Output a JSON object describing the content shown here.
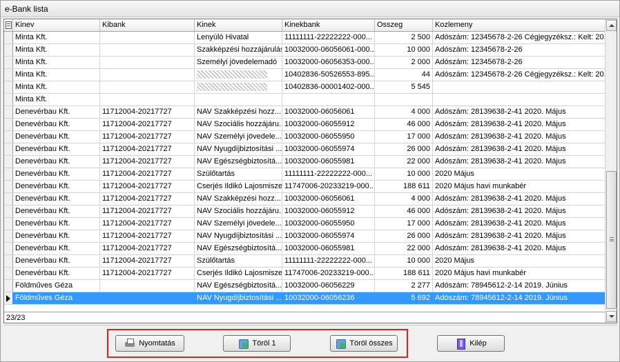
{
  "window": {
    "title": "e-Bank lista"
  },
  "columns": [
    "Kinev",
    "Kibank",
    "Kinek",
    "Kinekbank",
    "Osszeg",
    "Kozlemeny"
  ],
  "rows": [
    [
      "Minta Kft.",
      "",
      "Lenyúló Hivatal",
      "11111111-22222222-000...",
      "2 500",
      "Adószám: 12345678-2-26 Cégjegyzéksz.: Kelt: 20..."
    ],
    [
      "Minta Kft.",
      "",
      "Szakképzési hozzájárulás",
      "10032000-06056061-000...",
      "10 000",
      "Adószám: 12345678-2-26"
    ],
    [
      "Minta Kft.",
      "",
      "Személyi jövedelemadó",
      "10032000-06056353-000...",
      "2 000",
      "Adószám: 12345678-2-26"
    ],
    [
      "Minta Kft.",
      "",
      "",
      "10402836-50526553-895...",
      "44",
      "Adószám: 12345678-2-26 Cégjegyzéksz.: Kelt: 20..."
    ],
    [
      "Minta Kft.",
      "",
      "",
      "10402836-00001402-000...",
      "5 545",
      ""
    ],
    [
      "Minta Kft.",
      "",
      "",
      "",
      "",
      ""
    ],
    [
      "Denevérbau Kft.",
      "11712004-20217727",
      "NAV Szakképzési hozz...",
      "10032000-06056061",
      "4 000",
      "Adószám: 28139638-2-41   2020. Május"
    ],
    [
      "Denevérbau Kft.",
      "11712004-20217727",
      "NAV Szociális hozzájáru...",
      "10032000-06055912",
      "46 000",
      "Adószám: 28139638-2-41   2020. Május"
    ],
    [
      "Denevérbau Kft.",
      "11712004-20217727",
      "NAV Személyi jövedele...",
      "10032000-06055950",
      "17 000",
      "Adószám: 28139638-2-41   2020. Május"
    ],
    [
      "Denevérbau Kft.",
      "11712004-20217727",
      "NAV Nyugdíjbiztosítási ...",
      "10032000-06055974",
      "26 000",
      "Adószám: 28139638-2-41   2020. Május"
    ],
    [
      "Denevérbau Kft.",
      "11712004-20217727",
      "NAV Egészségbiztosítá...",
      "10032000-06055981",
      "22 000",
      "Adószám: 28139638-2-41   2020. Május"
    ],
    [
      "Denevérbau Kft.",
      "11712004-20217727",
      "Szülőtartás",
      "11111111-22222222-000...",
      "10 000",
      "2020 Május"
    ],
    [
      "Denevérbau Kft.",
      "11712004-20217727",
      "Cserjés Ildikó Lajosmisze",
      "11747006-20233219-000...",
      "188 611",
      "2020 Május havi munkabér"
    ],
    [
      "Denevérbau Kft.",
      "11712004-20217727",
      "NAV Szakképzési hozz...",
      "10032000-06056061",
      "4 000",
      "Adószám: 28139638-2-41   2020. Május"
    ],
    [
      "Denevérbau Kft.",
      "11712004-20217727",
      "NAV Szociális hozzájáru...",
      "10032000-06055912",
      "46 000",
      "Adószám: 28139638-2-41   2020. Május"
    ],
    [
      "Denevérbau Kft.",
      "11712004-20217727",
      "NAV Személyi jövedele...",
      "10032000-06055950",
      "17 000",
      "Adószám: 28139638-2-41   2020. Május"
    ],
    [
      "Denevérbau Kft.",
      "11712004-20217727",
      "NAV Nyugdíjbiztosítási ...",
      "10032000-06055974",
      "26 000",
      "Adószám: 28139638-2-41   2020. Május"
    ],
    [
      "Denevérbau Kft.",
      "11712004-20217727",
      "NAV Egészségbiztosítá...",
      "10032000-06055981",
      "22 000",
      "Adószám: 28139638-2-41   2020. Május"
    ],
    [
      "Denevérbau Kft.",
      "11712004-20217727",
      "Szülőtartás",
      "11111111-22222222-000...",
      "10 000",
      "2020 Május"
    ],
    [
      "Denevérbau Kft.",
      "11712004-20217727",
      "Cserjés Ildikó Lajosmisze",
      "11747006-20233219-000...",
      "188 611",
      "2020 Május havi munkabér"
    ],
    [
      "Földműves Géza",
      "",
      "NAV Egészségbiztosítá...",
      "10032000-06056229",
      "2 277",
      "Adószám: 78945612-2-14   2019. Június"
    ],
    [
      "Földműves Géza",
      "",
      "NAV Nyugdíjbiztosítási ...",
      "10032000-06056236",
      "5 692",
      "Adószám: 78945612-2-14   2019. Június"
    ]
  ],
  "selected_row": 21,
  "record_count": "23/23",
  "buttons": {
    "print": "Nyomtatás",
    "delete_one": "Töröl 1",
    "delete_all": "Töröl összes",
    "exit": "Kilép"
  },
  "colors": {
    "selection": "#3399ff",
    "highlight_frame": "#e02020"
  }
}
